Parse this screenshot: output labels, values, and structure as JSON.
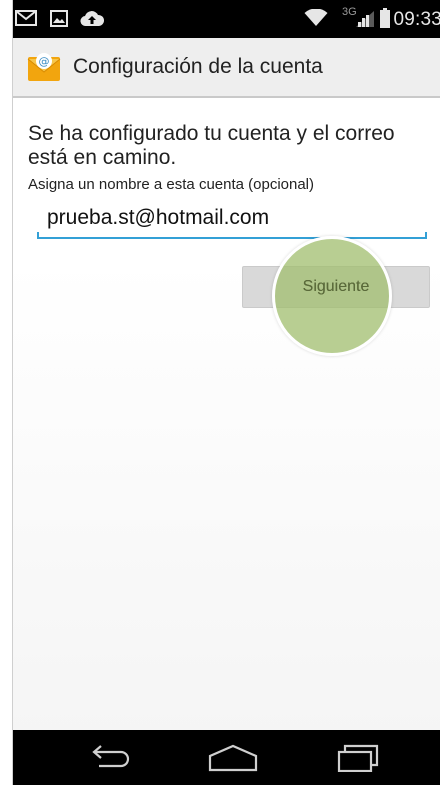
{
  "status_bar": {
    "time": "09:33",
    "network": "3G",
    "icons": [
      "mail-icon",
      "image-icon",
      "cloud-upload-icon",
      "wifi-icon",
      "signal-icon",
      "battery-icon"
    ]
  },
  "action_bar": {
    "title": "Configuración de la cuenta",
    "app_icon": "email-app-icon"
  },
  "content": {
    "message": "Se ha configurado tu cuenta y el correo está en camino.",
    "hint": "Asigna un nombre a esta cuenta (opcional)",
    "account_name_value": "prueba.st@hotmail.com",
    "next_button": "Siguiente"
  },
  "nav_bar": {
    "buttons": [
      "back-icon",
      "home-icon",
      "recents-icon"
    ]
  },
  "colors": {
    "accent": "#33a0d6",
    "touch_indicator": "#a0be6e"
  }
}
